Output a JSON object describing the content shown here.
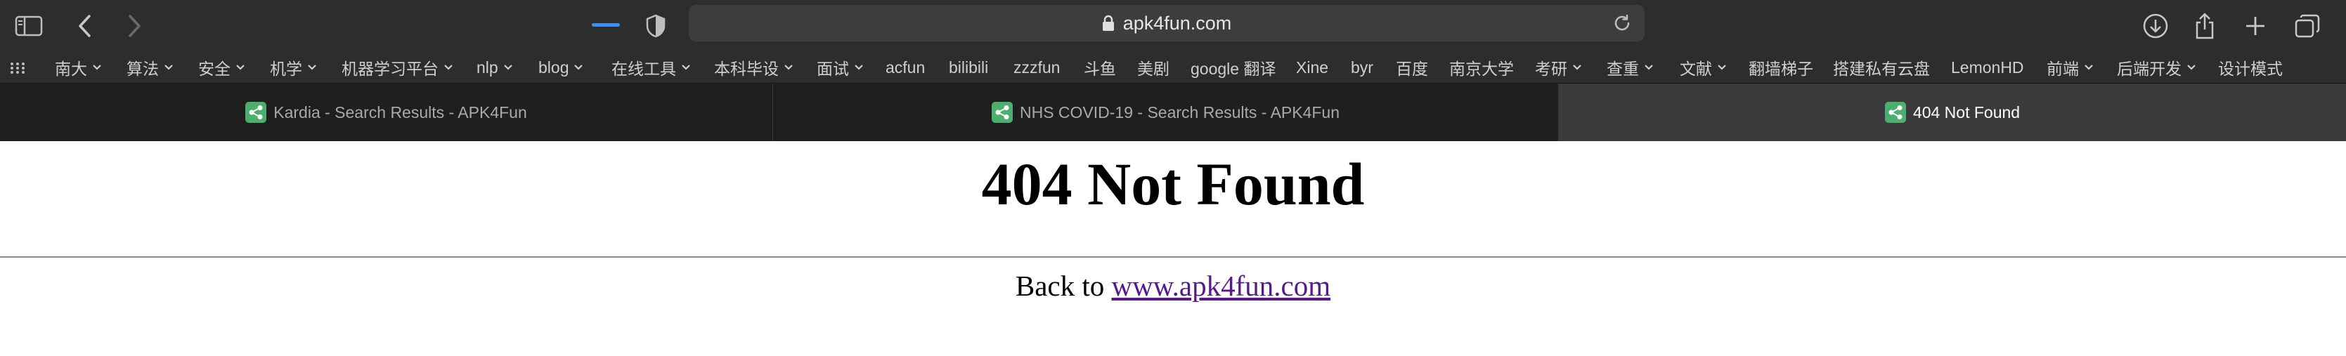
{
  "toolbar": {
    "url": "apk4fun.com",
    "icons": [
      "sidebar-icon",
      "back-icon",
      "forward-icon",
      "privacy-shield-icon",
      "lock-icon",
      "reload-icon",
      "download-icon",
      "share-icon",
      "new-tab-icon",
      "tab-overview-icon"
    ]
  },
  "bookmarks": [
    {
      "label": "南大",
      "menu": true
    },
    {
      "label": "算法",
      "menu": true
    },
    {
      "label": "安全",
      "menu": true
    },
    {
      "label": "机学",
      "menu": true
    },
    {
      "label": "机器学习平台",
      "menu": true
    },
    {
      "label": "nlp",
      "menu": true
    },
    {
      "label": "blog",
      "menu": true
    },
    {
      "label": "在线工具",
      "menu": true
    },
    {
      "label": "本科毕设",
      "menu": true
    },
    {
      "label": "面试",
      "menu": true
    },
    {
      "label": "acfun",
      "menu": false
    },
    {
      "label": "bilibili",
      "menu": false
    },
    {
      "label": "zzzfun",
      "menu": false
    },
    {
      "label": "斗鱼",
      "menu": false
    },
    {
      "label": "美剧",
      "menu": false
    },
    {
      "label": "google 翻译",
      "menu": false
    },
    {
      "label": "Xine",
      "menu": false
    },
    {
      "label": "byr",
      "menu": false
    },
    {
      "label": "百度",
      "menu": false
    },
    {
      "label": "南京大学",
      "menu": false
    },
    {
      "label": "考研",
      "menu": true
    },
    {
      "label": "查重",
      "menu": true
    },
    {
      "label": "文献",
      "menu": true
    },
    {
      "label": "翻墙梯子",
      "menu": false
    },
    {
      "label": "搭建私有云盘",
      "menu": false
    },
    {
      "label": "LemonHD",
      "menu": false
    },
    {
      "label": "前端",
      "menu": true
    },
    {
      "label": "后端开发",
      "menu": true
    },
    {
      "label": "设计模式",
      "menu": false
    }
  ],
  "tabs": [
    {
      "title": "Kardia - Search Results - APK4Fun",
      "active": false
    },
    {
      "title": "NHS COVID-19 - Search Results - APK4Fun",
      "active": false
    },
    {
      "title": "404 Not Found",
      "active": true
    }
  ],
  "page": {
    "heading": "404 Not Found",
    "back_prefix": "Back to",
    "back_link": "www.apk4fun.com"
  },
  "colors": {
    "toolbar_bg": "#2d2d2d",
    "tabbar_bg": "#1f1f1f",
    "active_tab_bg": "#3a3a3c",
    "accent": "#3d8ef7",
    "link_visited": "#551a8b"
  }
}
